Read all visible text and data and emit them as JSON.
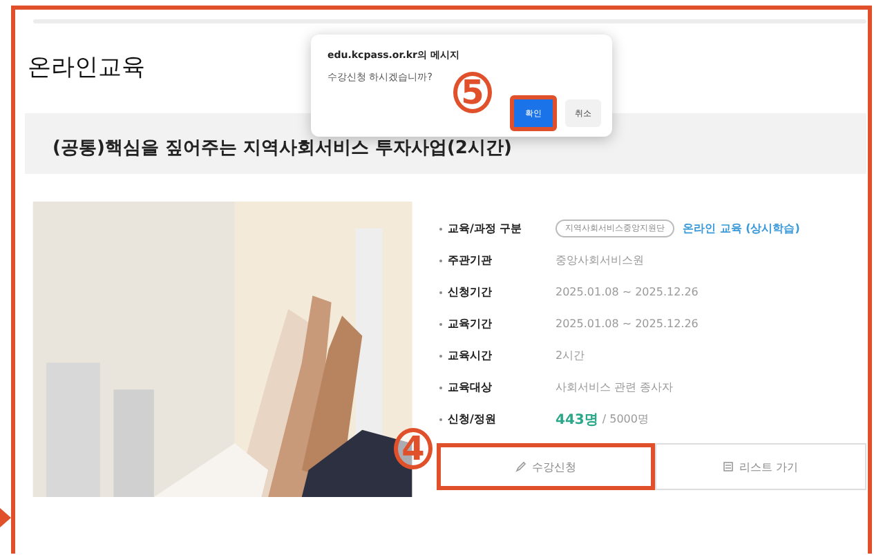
{
  "page": {
    "title": "온라인교육"
  },
  "course": {
    "title": "(공통)핵심을 짚어주는 지역사회서비스 투자사업(2시간)",
    "details": [
      {
        "label": "교육/과정 구분",
        "tag": "지역사회서비스중앙지원단",
        "value": "온라인 교육 (상시학습)",
        "kind": "tagged"
      },
      {
        "label": "주관기관",
        "value": "중앙사회서비스원",
        "kind": "plain"
      },
      {
        "label": "신청기간",
        "value": "2025.01.08 ~ 2025.12.26",
        "kind": "plain"
      },
      {
        "label": "교육기간",
        "value": "2025.01.08 ~ 2025.12.26",
        "kind": "plain"
      },
      {
        "label": "교육시간",
        "value": "2시간",
        "kind": "plain"
      },
      {
        "label": "교육대상",
        "value": "사회서비스 관련 종사자",
        "kind": "plain"
      },
      {
        "label": "신청/정원",
        "count": "443명",
        "value": "/ 5000명",
        "kind": "count"
      }
    ],
    "buttons": [
      {
        "label": "수강신청",
        "kind": "apply",
        "highlighted": true
      },
      {
        "label": "리스트 가기",
        "kind": "list",
        "highlighted": false
      }
    ]
  },
  "dialog": {
    "title": "edu.kcpass.or.kr의 메시지",
    "message": "수강신청 하시겠습니까?",
    "buttons": [
      {
        "label": "확인",
        "primary": true,
        "highlighted": true
      },
      {
        "label": "취소",
        "primary": false,
        "highlighted": false
      }
    ]
  },
  "annotations": [
    {
      "label": "5"
    },
    {
      "label": "4"
    }
  ]
}
